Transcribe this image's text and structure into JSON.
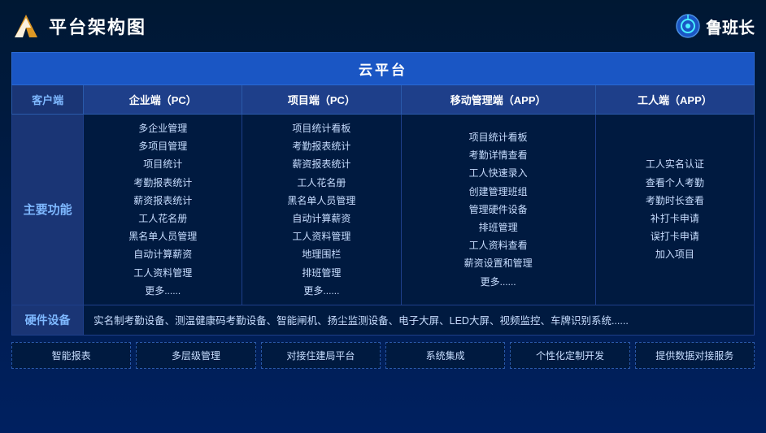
{
  "header": {
    "title": "平台架构图",
    "brand": "鲁班长"
  },
  "cloud": {
    "label": "云平台"
  },
  "columns": {
    "client": "客户端",
    "enterprise": "企业端（PC）",
    "project": "项目端（PC）",
    "mobile": "移动管理端（APP）",
    "worker": "工人端（APP）"
  },
  "main_func_label": "主要功能",
  "enterprise_funcs": [
    "多企业管理",
    "多项目管理",
    "项目统计",
    "考勤报表统计",
    "薪资报表统计",
    "工人花名册",
    "黑名单人员管理",
    "自动计算薪资",
    "工人资料管理",
    "更多......"
  ],
  "project_funcs": [
    "项目统计看板",
    "考勤报表统计",
    "薪资报表统计",
    "工人花名册",
    "黑名单人员管理",
    "自动计算薪资",
    "工人资料管理",
    "地理围栏",
    "排班管理",
    "更多......"
  ],
  "mobile_funcs": [
    "项目统计看板",
    "考勤详情查看",
    "工人快速录入",
    "创建管理班组",
    "管理硬件设备",
    "排班管理",
    "工人资料查看",
    "薪资设置和管理",
    "更多......"
  ],
  "worker_funcs": [
    "工人实名认证",
    "查看个人考勤",
    "考勤时长查看",
    "补打卡申请",
    "误打卡申请",
    "加入项目"
  ],
  "hardware": {
    "label": "硬件设备",
    "content": "实名制考勤设备、测温健康码考勤设备、智能闸机、扬尘监测设备、电子大屏、LED大屏、视频监控、车牌识别系统......"
  },
  "features": [
    "智能报表",
    "多层级管理",
    "对接住建局平台",
    "系统集成",
    "个性化定制开发",
    "提供数据对接服务"
  ]
}
